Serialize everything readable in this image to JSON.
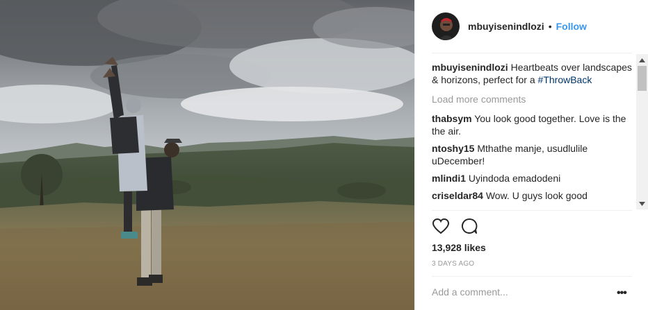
{
  "post": {
    "username": "mbuyisenindlozi",
    "separator": "•",
    "follow_label": "Follow",
    "caption_text": "Heartbeats over landscapes & horizons, perfect for a ",
    "caption_hashtag": "#ThrowBack",
    "load_more_label": "Load more comments",
    "comments": [
      {
        "user": "thabsym",
        "text": "You look good together. Love is the the air."
      },
      {
        "user": "ntoshy15",
        "text": "Mthathe manje, usudlulile uDecember!"
      },
      {
        "user": "mlindi1",
        "text": "Uyindoda emadodeni"
      },
      {
        "user": "criseldar84",
        "text": "Wow. U guys look good"
      }
    ],
    "likes_label": "13,928 likes",
    "age_label": "3 DAYS AGO",
    "add_comment_placeholder": "Add a comment...",
    "more_label": "•••"
  },
  "icons": {
    "like": "heart-icon",
    "comment": "comment-bubble-icon",
    "scroll_up": "scroll-up-arrow-icon",
    "scroll_down": "scroll-down-arrow-icon"
  },
  "colors": {
    "follow": "#3897f0",
    "hashtag": "#003569",
    "muted": "#999999",
    "text": "#262626"
  }
}
